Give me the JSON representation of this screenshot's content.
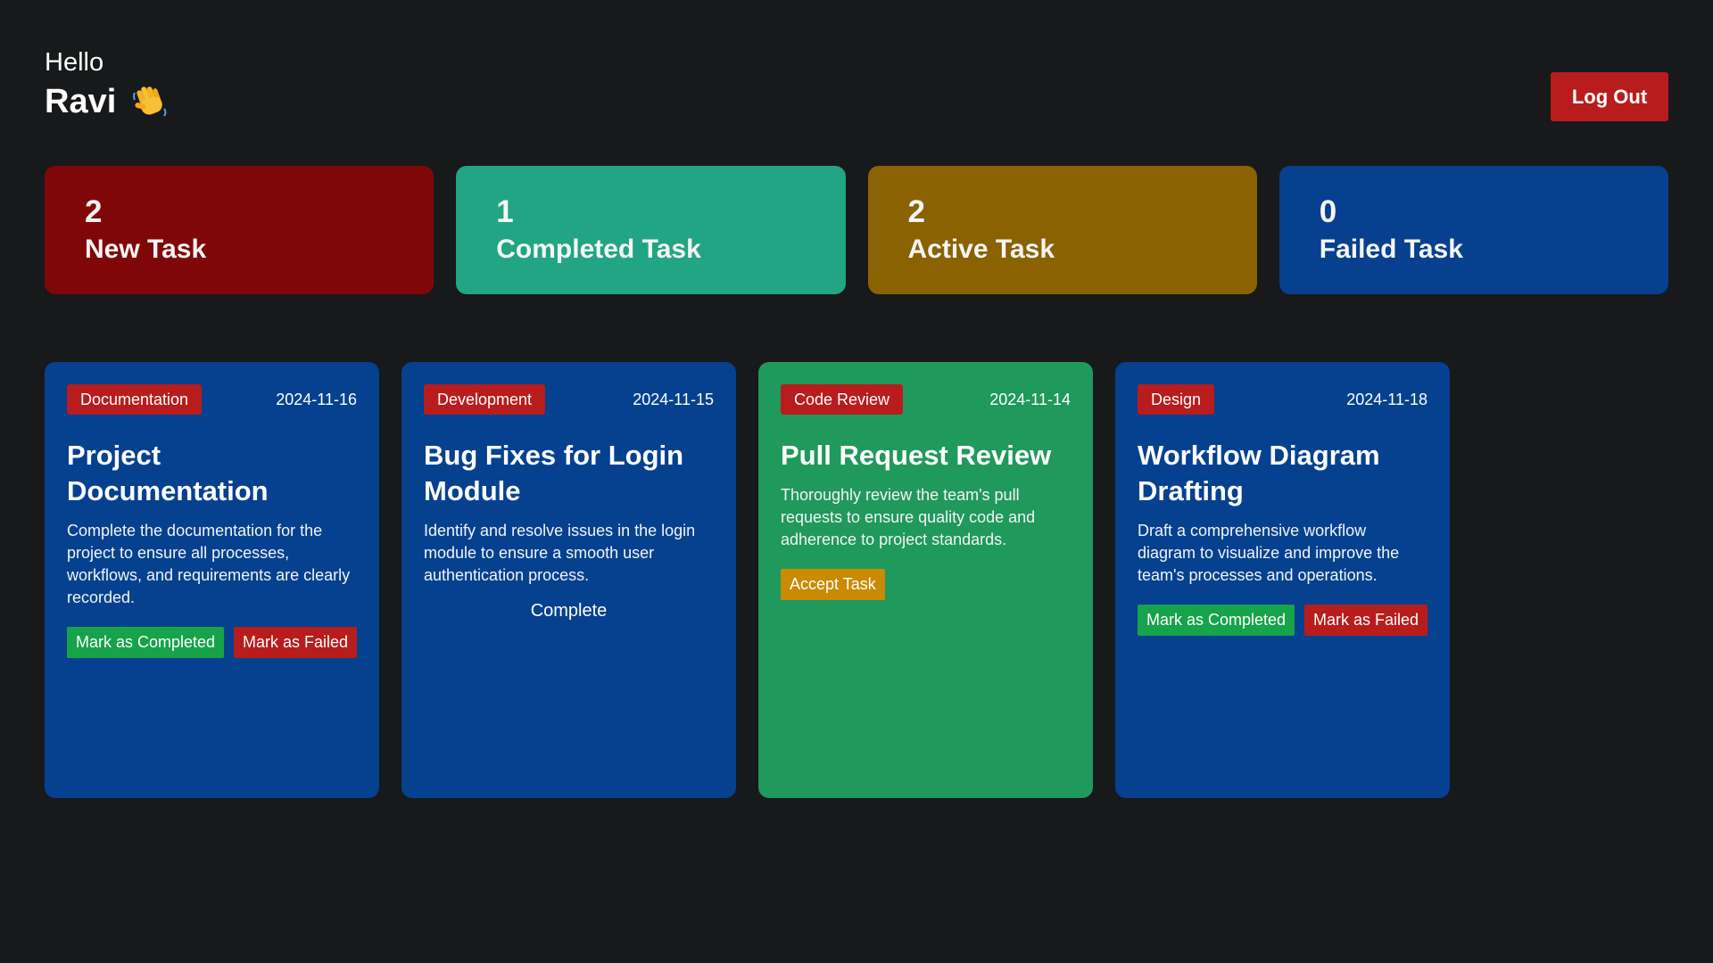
{
  "header": {
    "hello": "Hello",
    "name": "Ravi",
    "wave_emoji": "👋",
    "logout_label": "Log Out"
  },
  "stats": [
    {
      "count": "2",
      "label": "New Task",
      "color": "#800708"
    },
    {
      "count": "1",
      "label": "Completed Task",
      "color": "#21a584"
    },
    {
      "count": "2",
      "label": "Active Task",
      "color": "#8a6201"
    },
    {
      "count": "0",
      "label": "Failed Task",
      "color": "#06408f"
    }
  ],
  "tasks": [
    {
      "category": "Documentation",
      "date": "2024-11-16",
      "title": "Project Documentation",
      "description": "Complete the documentation for the project to ensure all processes, workflows, and requirements are clearly recorded.",
      "color": "#05418f",
      "complete_label": "Mark as Completed",
      "fail_label": "Mark as Failed"
    },
    {
      "category": "Development",
      "date": "2024-11-15",
      "title": "Bug Fixes for Login Module",
      "description": "Identify and resolve issues in the login module to ensure a smooth user authentication process.",
      "color": "#05418f",
      "status": "Complete"
    },
    {
      "category": "Code Review",
      "date": "2024-11-14",
      "title": "Pull Request Review",
      "description": "Thoroughly review the team's pull requests to ensure quality code and adherence to project standards.",
      "color": "#1f995c",
      "accept_label": "Accept Task"
    },
    {
      "category": "Design",
      "date": "2024-11-18",
      "title": "Workflow Diagram Drafting",
      "description": "Draft a comprehensive workflow diagram to visualize and improve the team's processes and operations.",
      "color": "#05418f",
      "complete_label": "Mark as Completed",
      "fail_label": "Mark as Failed"
    }
  ]
}
